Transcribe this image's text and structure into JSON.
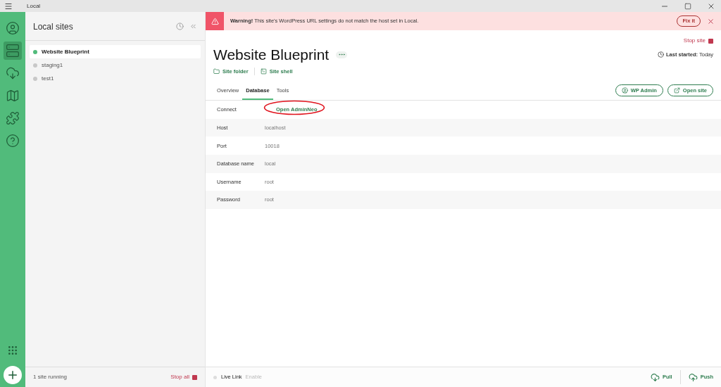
{
  "window": {
    "title": "Local"
  },
  "rail": [
    {
      "kind": "user",
      "selected": false
    },
    {
      "kind": "sites",
      "selected": true
    },
    {
      "kind": "cloud",
      "selected": false
    },
    {
      "kind": "blueprint",
      "selected": false
    },
    {
      "kind": "addons",
      "selected": false
    },
    {
      "kind": "help",
      "selected": false
    }
  ],
  "sidebar": {
    "title": "Local sites",
    "items": [
      {
        "label": "Website Blueprint",
        "selected": true,
        "running": true
      },
      {
        "label": "staging1",
        "selected": false,
        "running": false
      },
      {
        "label": "test1",
        "selected": false,
        "running": false
      }
    ],
    "status": "1 site running",
    "stop_all": "Stop all"
  },
  "warning": {
    "text": "**Warning!** This site's WordPress URL settings do not match the host set in Local.",
    "fix": "Fix it"
  },
  "site": {
    "stop": "Stop site",
    "name": "Website Blueprint",
    "last_started_label": "Last started:",
    "last_started": "Today",
    "folder": "Site folder",
    "shell": "Site shell"
  },
  "tabs": [
    {
      "label": "Overview",
      "selected": false
    },
    {
      "label": "Database",
      "selected": true
    },
    {
      "label": "Tools",
      "selected": false
    }
  ],
  "actions": [
    "WP Admin",
    "Open site"
  ],
  "rows": [
    {
      "label": "Connect",
      "value": "Open AdminNeo",
      "kind": "link",
      "highlighted": true
    },
    {
      "label": "Host",
      "value": "localhost",
      "kind": "text"
    },
    {
      "label": "Port",
      "value": "10018",
      "kind": "text"
    },
    {
      "label": "Database name",
      "value": "local",
      "kind": "text"
    },
    {
      "label": "Username",
      "value": "root",
      "kind": "text"
    },
    {
      "label": "Password",
      "value": "root",
      "kind": "text"
    }
  ],
  "footer": {
    "live_link": "Live Link",
    "enable": "Enable",
    "pull": "Pull",
    "push": "Push"
  }
}
